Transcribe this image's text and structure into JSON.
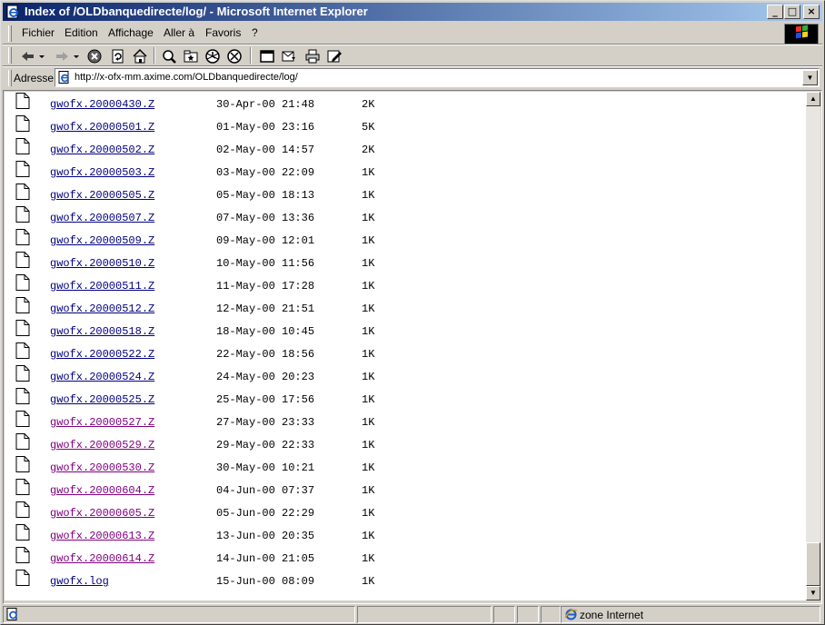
{
  "window": {
    "title": "Index of /OLDbanquedirecte/log/ - Microsoft Internet Explorer",
    "minimize": "_",
    "maximize": "□",
    "close": "×"
  },
  "menu": {
    "items": [
      {
        "label": "Fichier"
      },
      {
        "label": "Edition"
      },
      {
        "label": "Affichage"
      },
      {
        "label": "Aller à"
      },
      {
        "label": "Favoris"
      },
      {
        "label": "?"
      }
    ]
  },
  "toolbar": {
    "buttons": [
      "back-icon",
      "forward-icon",
      "stop-icon",
      "refresh-icon",
      "home-icon",
      "search-icon",
      "favorites-icon",
      "history-icon",
      "channels-icon",
      "fullscreen-icon",
      "mail-icon",
      "print-icon",
      "edit-icon"
    ]
  },
  "address": {
    "label": "Adresse",
    "url": "http://x-ofx-mm.axime.com/OLDbanquedirecte/log/"
  },
  "files": [
    {
      "name": "gwofx.20000430.Z",
      "date": "30-Apr-00 21:48",
      "size": "2K",
      "visited": false
    },
    {
      "name": "gwofx.20000501.Z",
      "date": "01-May-00 23:16",
      "size": "5K",
      "visited": false
    },
    {
      "name": "gwofx.20000502.Z",
      "date": "02-May-00 14:57",
      "size": "2K",
      "visited": false
    },
    {
      "name": "gwofx.20000503.Z",
      "date": "03-May-00 22:09",
      "size": "1K",
      "visited": false
    },
    {
      "name": "gwofx.20000505.Z",
      "date": "05-May-00 18:13",
      "size": "1K",
      "visited": false
    },
    {
      "name": "gwofx.20000507.Z",
      "date": "07-May-00 13:36",
      "size": "1K",
      "visited": false
    },
    {
      "name": "gwofx.20000509.Z",
      "date": "09-May-00 12:01",
      "size": "1K",
      "visited": false
    },
    {
      "name": "gwofx.20000510.Z",
      "date": "10-May-00 11:56",
      "size": "1K",
      "visited": false
    },
    {
      "name": "gwofx.20000511.Z",
      "date": "11-May-00 17:28",
      "size": "1K",
      "visited": false
    },
    {
      "name": "gwofx.20000512.Z",
      "date": "12-May-00 21:51",
      "size": "1K",
      "visited": false
    },
    {
      "name": "gwofx.20000518.Z",
      "date": "18-May-00 10:45",
      "size": "1K",
      "visited": false
    },
    {
      "name": "gwofx.20000522.Z",
      "date": "22-May-00 18:56",
      "size": "1K",
      "visited": false
    },
    {
      "name": "gwofx.20000524.Z",
      "date": "24-May-00 20:23",
      "size": "1K",
      "visited": false
    },
    {
      "name": "gwofx.20000525.Z",
      "date": "25-May-00 17:56",
      "size": "1K",
      "visited": false
    },
    {
      "name": "gwofx.20000527.Z",
      "date": "27-May-00 23:33",
      "size": "1K",
      "visited": true
    },
    {
      "name": "gwofx.20000529.Z",
      "date": "29-May-00 22:33",
      "size": "1K",
      "visited": true
    },
    {
      "name": "gwofx.20000530.Z",
      "date": "30-May-00 10:21",
      "size": "1K",
      "visited": true
    },
    {
      "name": "gwofx.20000604.Z",
      "date": "04-Jun-00 07:37",
      "size": "1K",
      "visited": true
    },
    {
      "name": "gwofx.20000605.Z",
      "date": "05-Jun-00 22:29",
      "size": "1K",
      "visited": true
    },
    {
      "name": "gwofx.20000613.Z",
      "date": "13-Jun-00 20:35",
      "size": "1K",
      "visited": true
    },
    {
      "name": "gwofx.20000614.Z",
      "date": "14-Jun-00 21:05",
      "size": "1K",
      "visited": true
    },
    {
      "name": "gwofx.log",
      "date": "15-Jun-00 08:09",
      "size": "1K",
      "visited": false
    }
  ],
  "statusbar": {
    "zone": "zone Internet"
  },
  "colors": {
    "link": "#00007f",
    "visited": "#800080",
    "titlebar_start": "#0a246a",
    "titlebar_end": "#a6caf0"
  }
}
